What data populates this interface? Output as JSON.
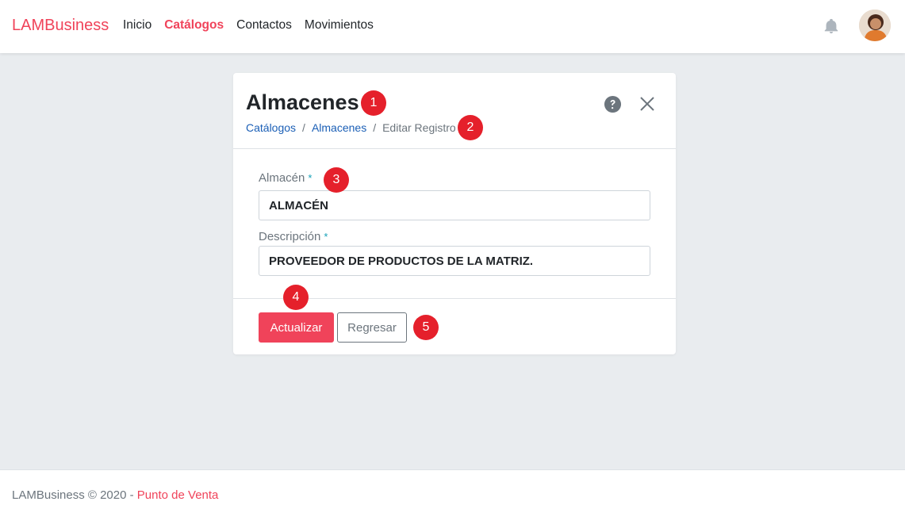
{
  "navbar": {
    "brand": "LAMBusiness",
    "links": [
      {
        "label": "Inicio",
        "active": false
      },
      {
        "label": "Catálogos",
        "active": true
      },
      {
        "label": "Contactos",
        "active": false
      },
      {
        "label": "Movimientos",
        "active": false
      }
    ],
    "notification_icon": "bell-icon",
    "avatar_icon": "user-avatar"
  },
  "card": {
    "title": "Almacenes",
    "breadcrumb": {
      "items": [
        "Catálogos",
        "Almacenes"
      ],
      "current": "Editar Registro",
      "separator": "/"
    },
    "help_icon": "question-circle-icon",
    "close_icon": "close-icon"
  },
  "form": {
    "almacen_label": "Almacén",
    "almacen_value": "ALMACÉN",
    "descripcion_label": "Descripción",
    "descripcion_value": "PROVEEDOR DE PRODUCTOS DE LA MATRIZ.",
    "required_mark": "*"
  },
  "actions": {
    "submit_label": "Actualizar",
    "back_label": "Regresar"
  },
  "markers": [
    "1",
    "2",
    "3",
    "4",
    "5"
  ],
  "footer": {
    "text": "LAMBusiness © 2020 - ",
    "link": "Punto de Venta"
  },
  "colors": {
    "accent": "#f0435a",
    "link": "#1b5fb6",
    "required": "#17a2b8",
    "marker": "#e5202b",
    "background": "#e9ecef"
  }
}
